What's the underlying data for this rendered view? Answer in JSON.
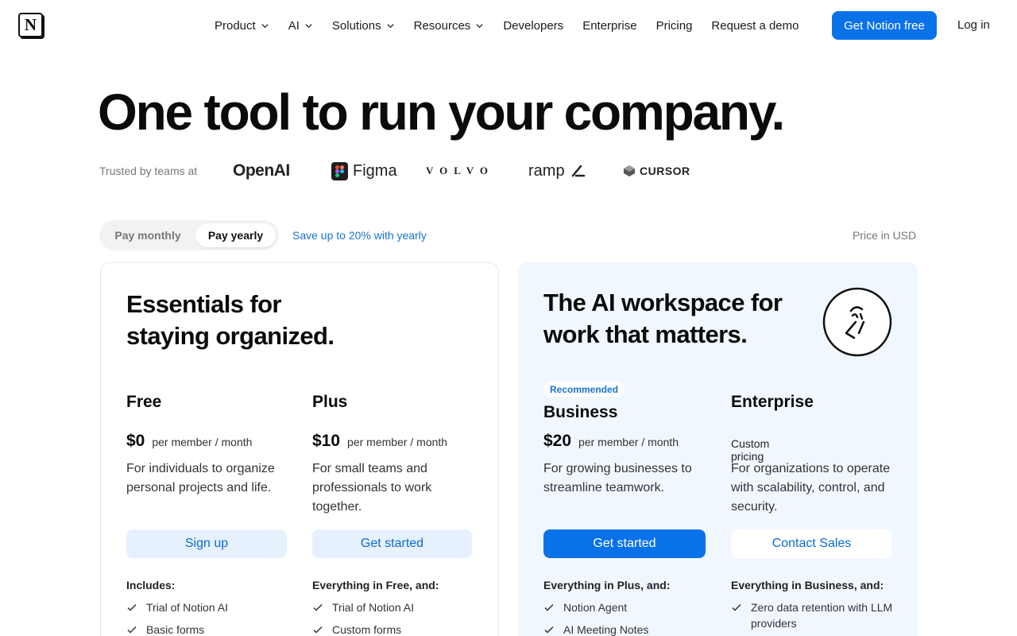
{
  "nav": {
    "logo_letter": "N",
    "items": [
      {
        "label": "Product",
        "has_menu": true
      },
      {
        "label": "AI",
        "has_menu": true
      },
      {
        "label": "Solutions",
        "has_menu": true
      },
      {
        "label": "Resources",
        "has_menu": true
      },
      {
        "label": "Developers",
        "has_menu": false
      },
      {
        "label": "Enterprise",
        "has_menu": false
      },
      {
        "label": "Pricing",
        "has_menu": false
      },
      {
        "label": "Request a demo",
        "has_menu": false
      }
    ],
    "cta_label": "Get Notion free",
    "login_label": "Log in"
  },
  "hero": {
    "title": "One tool to run your company.",
    "trusted_label": "Trusted by teams at",
    "logos": [
      "OpenAI",
      "Figma",
      "VOLVO",
      "ramp",
      "CURSOR"
    ]
  },
  "billing": {
    "monthly_label": "Pay monthly",
    "yearly_label": "Pay yearly",
    "selected": "yearly",
    "save_note": "Save up to 20% with yearly",
    "currency_note": "Price in USD"
  },
  "groups": {
    "essentials_heading_line1": "Essentials for",
    "essentials_heading_line2": "staying organized.",
    "ai_heading_line1": "The AI workspace for",
    "ai_heading_line2": "work that matters."
  },
  "plans": {
    "free": {
      "name": "Free",
      "price": "$0",
      "per": "per member / month",
      "description": "For individuals to organize personal projects and life.",
      "button": "Sign up",
      "includes_title": "Includes:",
      "features": [
        "Trial of Notion AI",
        "Basic forms"
      ]
    },
    "plus": {
      "name": "Plus",
      "price": "$10",
      "per": "per member / month",
      "description": "For small teams and professionals to work together.",
      "button": "Get started",
      "includes_title": "Everything in Free, and:",
      "features": [
        "Trial of Notion AI",
        "Custom forms"
      ]
    },
    "business": {
      "badge": "Recommended",
      "name": "Business",
      "price": "$20",
      "per": "per member / month",
      "description": "For growing businesses to streamline teamwork.",
      "button": "Get started",
      "includes_title": "Everything in Plus, and:",
      "features": [
        "Notion Agent",
        "AI Meeting Notes"
      ]
    },
    "enterprise": {
      "name": "Enterprise",
      "custom_pricing": "Custom pricing",
      "description": "For organizations to operate with scalability, control, and security.",
      "button": "Contact Sales",
      "includes_title": "Everything in Business, and:",
      "features": [
        "Zero data retention with LLM providers"
      ]
    }
  },
  "colors": {
    "accent": "#0a72e9",
    "link": "#1a72d1",
    "ai_card_bg": "#f1f7fe",
    "light_button_bg": "#e6f1fd"
  }
}
